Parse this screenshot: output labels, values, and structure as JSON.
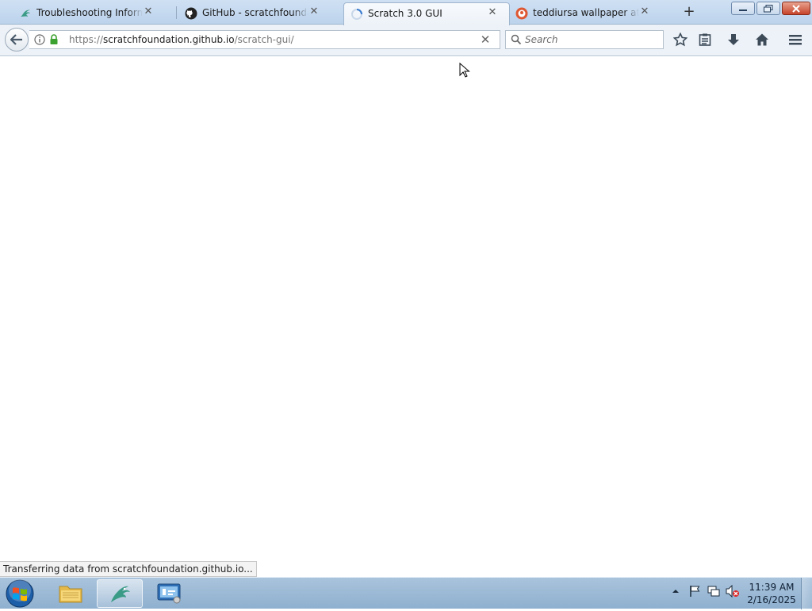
{
  "browser": {
    "tabs": [
      {
        "title": "Troubleshooting Information",
        "icon": "scratch-dragon-icon",
        "active": false
      },
      {
        "title": "GitHub - scratchfoundation/scratch-gui",
        "icon": "github-icon",
        "active": false
      },
      {
        "title": "Scratch 3.0 GUI",
        "icon": "loading-spinner-icon",
        "active": true
      },
      {
        "title": "teddiursa wallpaper at DuckDuckGo",
        "icon": "duckduckgo-icon",
        "active": false
      }
    ],
    "new_tab_label": "+",
    "url": {
      "prefix": "https://",
      "domain": "scratchfoundation.github.io",
      "path": "/scratch-gui/"
    },
    "search_placeholder": "Search",
    "status_text": "Transferring data from scratchfoundation.github.io..."
  },
  "taskbar": {
    "time": "11:39 AM",
    "date": "2/16/2025"
  },
  "colors": {
    "accent": "#3b7ccf",
    "lock_green": "#3ba130"
  }
}
